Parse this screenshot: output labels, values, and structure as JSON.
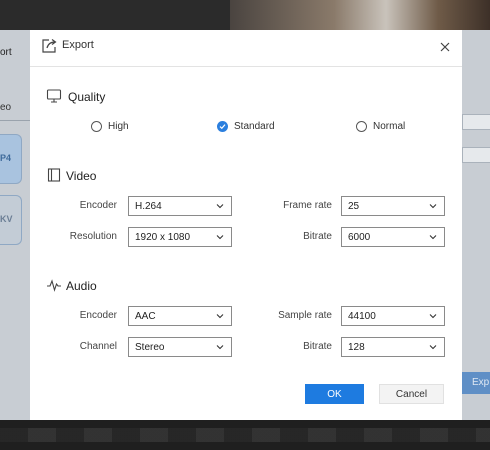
{
  "background": {
    "left_title": "ort",
    "left_video": "eo",
    "card1_label": "P4",
    "card2_label": "KV",
    "export_button": "Exp"
  },
  "dialog": {
    "title": "Export",
    "quality": {
      "title": "Quality",
      "options": [
        "High",
        "Standard",
        "Normal"
      ],
      "selected": "Standard"
    },
    "video": {
      "title": "Video",
      "encoder_label": "Encoder",
      "encoder_value": "H.264",
      "resolution_label": "Resolution",
      "resolution_value": "1920 x 1080",
      "frame_rate_label": "Frame rate",
      "frame_rate_value": "25",
      "bitrate_label": "Bitrate",
      "bitrate_value": "6000"
    },
    "audio": {
      "title": "Audio",
      "encoder_label": "Encoder",
      "encoder_value": "AAC",
      "channel_label": "Channel",
      "channel_value": "Stereo",
      "sample_rate_label": "Sample rate",
      "sample_rate_value": "44100",
      "bitrate_label": "Bitrate",
      "bitrate_value": "128"
    },
    "ok_label": "OK",
    "cancel_label": "Cancel"
  },
  "colors": {
    "accent": "#1e7be0",
    "radio_checked": "#2b7fde",
    "overlay": "#3a3a3a"
  },
  "icons": {
    "title": "export-icon",
    "close": "close-icon",
    "quality": "monitor-icon",
    "video": "film-icon",
    "audio": "waveform-icon",
    "dropdown": "chevron-down-icon",
    "check": "check-icon"
  }
}
